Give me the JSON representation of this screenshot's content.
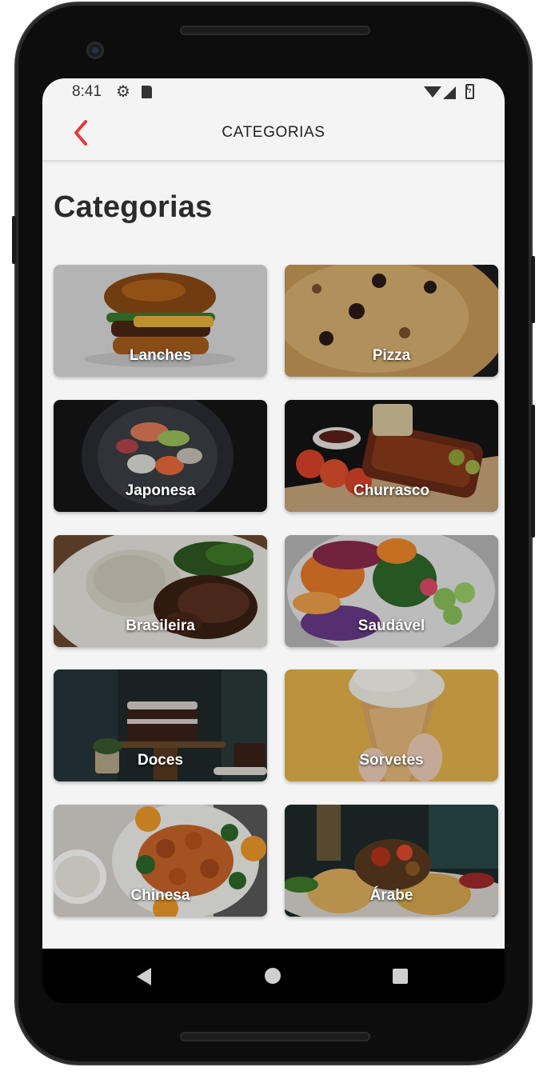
{
  "status_bar": {
    "time": "8:41",
    "icons": [
      "gear-icon",
      "sd-card-icon",
      "wifi-icon",
      "signal-icon",
      "battery-charging-icon"
    ]
  },
  "app_bar": {
    "back_icon": "chevron-left-icon",
    "title": "CATEGORIAS",
    "accent_color": "#e53935"
  },
  "page": {
    "heading": "Categorias"
  },
  "categories": [
    {
      "label": "Lanches",
      "image": "burger-photo"
    },
    {
      "label": "Pizza",
      "image": "pizza-photo"
    },
    {
      "label": "Japonesa",
      "image": "sushi-photo"
    },
    {
      "label": "Churrasco",
      "image": "ribs-photo"
    },
    {
      "label": "Brasileira",
      "image": "rice-and-beef-photo"
    },
    {
      "label": "Saudável",
      "image": "salad-photo"
    },
    {
      "label": "Doces",
      "image": "cake-photo"
    },
    {
      "label": "Sorvetes",
      "image": "ice-cream-photo"
    },
    {
      "label": "Chinesa",
      "image": "chicken-orange-photo"
    },
    {
      "label": "Árabe",
      "image": "arabic-dish-photo"
    }
  ],
  "nav_bar": {
    "buttons": [
      "nav-back-icon",
      "nav-home-icon",
      "nav-recents-icon"
    ]
  }
}
